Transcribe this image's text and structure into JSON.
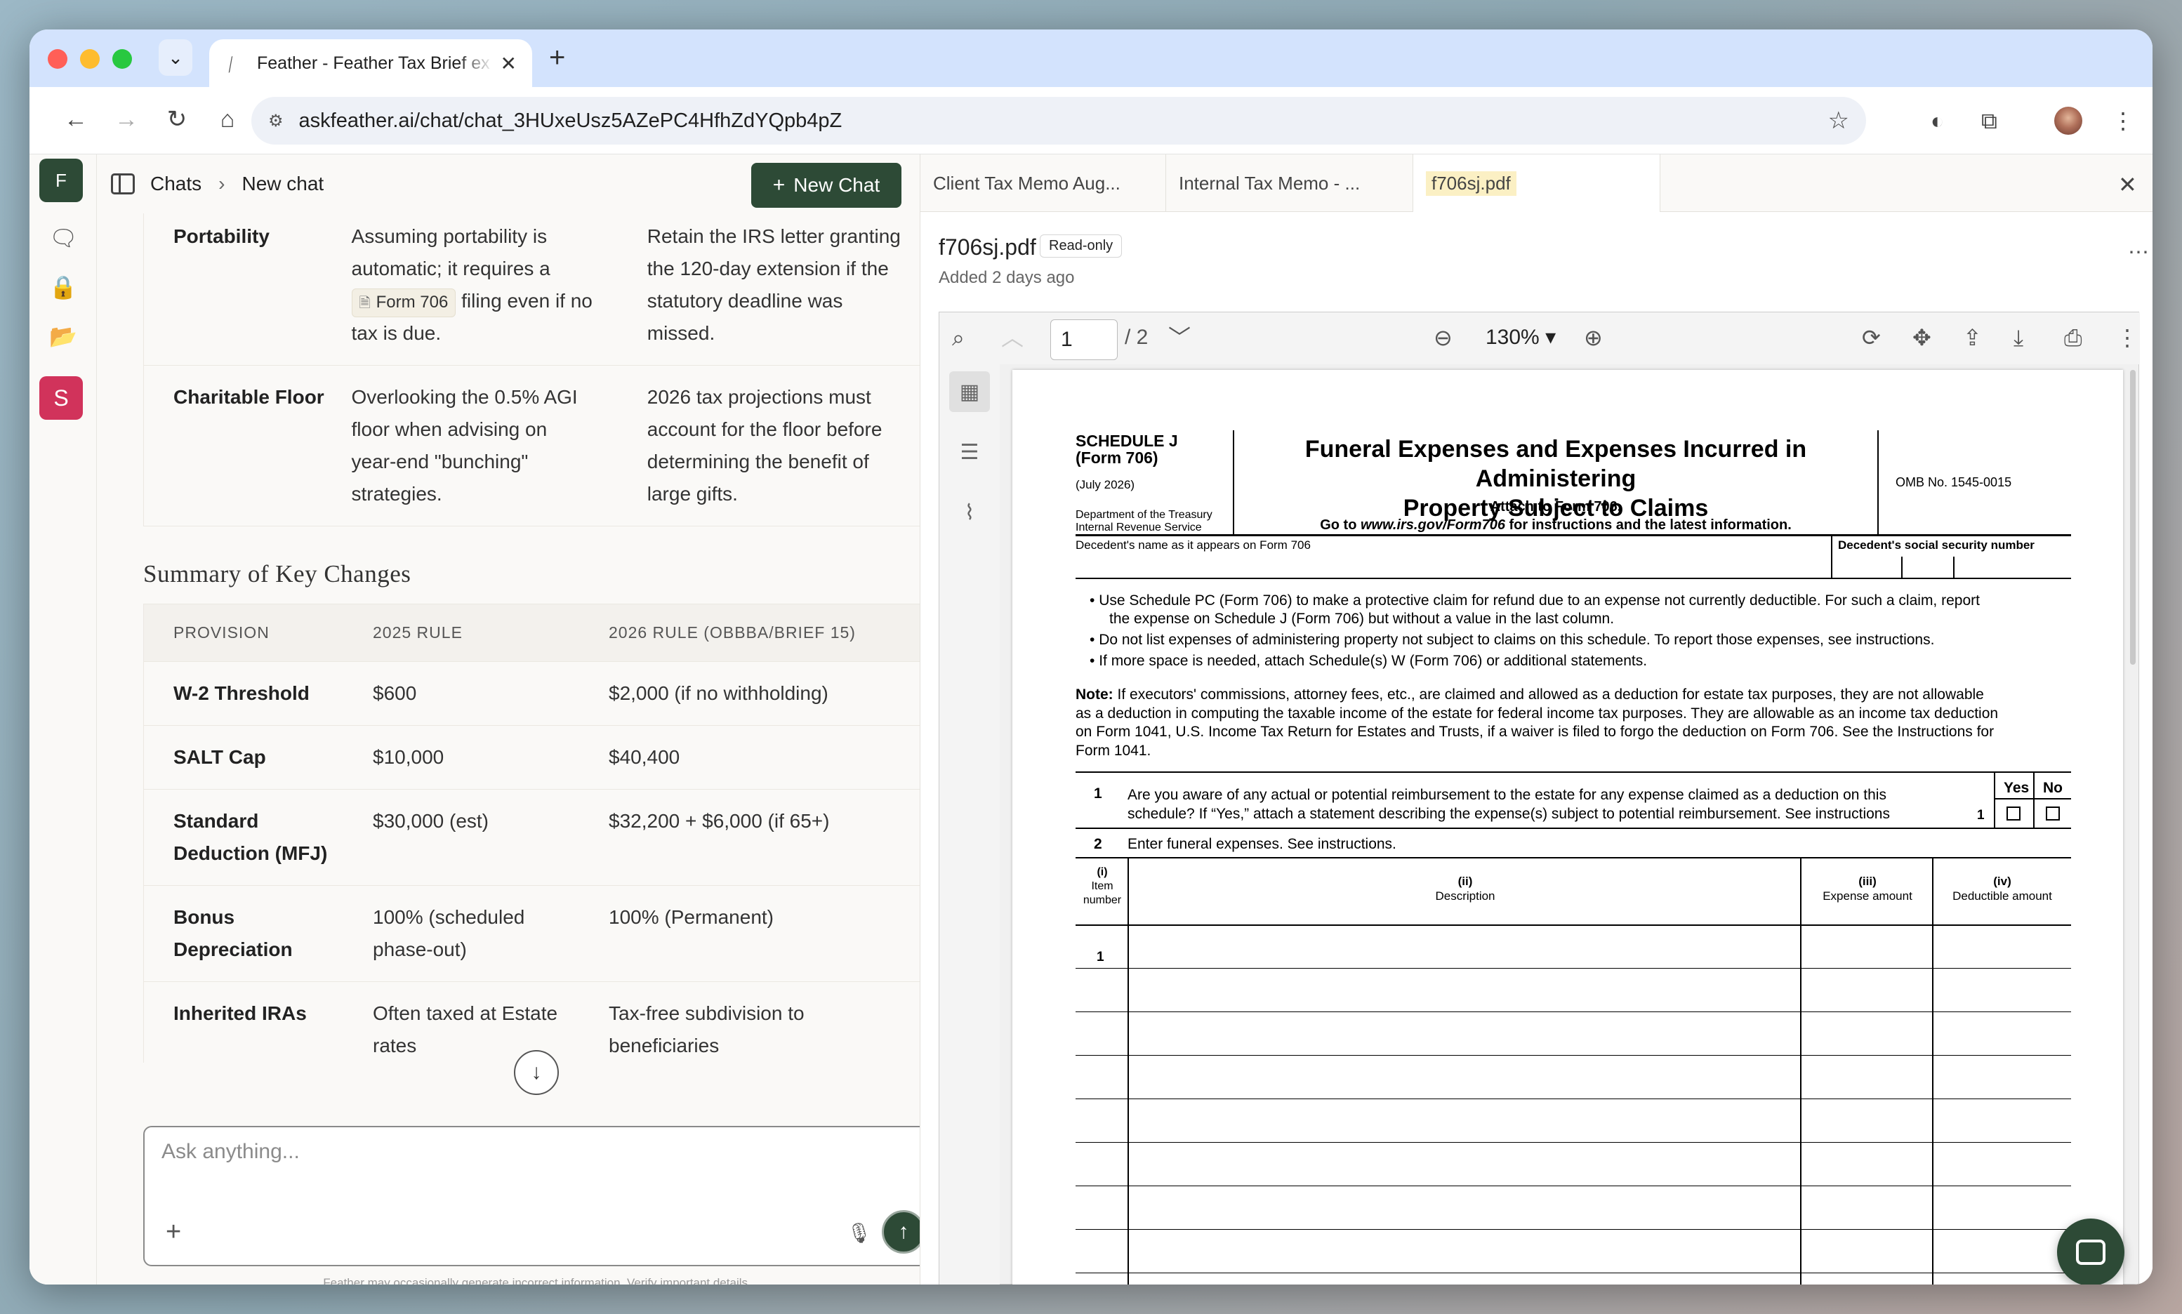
{
  "browser": {
    "tab_title": "Feather - Feather Tax Brief ex",
    "new_tab_icon": "+",
    "url": "askfeather.ai/chat/chat_3HUxeUsz5AZePC4HfhZdYQpb4pZ"
  },
  "rail": {
    "workspace_initial": "F",
    "user_initial": "S",
    "colors": {
      "workspace": "#2d4a36",
      "user": "#d1335b"
    }
  },
  "chat": {
    "breadcrumb_root": "Chats",
    "breadcrumb_current": "New chat",
    "new_chat_label": "New Chat",
    "top_table": [
      {
        "topic": "Portability",
        "pitfall": [
          "Assuming portability is",
          "automatic; it requires a"
        ],
        "chip": "Form 706",
        "pitfall_after_chip": " filing even if no",
        "pitfall_end": "tax is due.",
        "action": [
          "Retain the IRS letter granting",
          "the 120-day extension if the",
          "statutory deadline was",
          "missed."
        ]
      },
      {
        "topic": "Charitable Floor",
        "pitfall": [
          "Overlooking the 0.5% AGI",
          "floor when advising on",
          "year-end \"bunching\"",
          "strategies."
        ],
        "action": [
          "2026 tax projections must",
          "account for the floor before",
          "determining the benefit of",
          "large gifts."
        ]
      }
    ],
    "summary_heading": "Summary of Key Changes",
    "summary_headers": [
      "PROVISION",
      "2025 RULE",
      "2026 RULE (OBBBA/BRIEF 15)"
    ],
    "summary_rows": [
      {
        "provision": "W-2 Threshold",
        "rule_2025": "$600",
        "rule_2026": "$2,000 (if no withholding)"
      },
      {
        "provision": "SALT Cap",
        "rule_2025": "$10,000",
        "rule_2026": "$40,400"
      },
      {
        "provision": "Standard Deduction (MFJ)",
        "rule_2025": "$30,000 (est)",
        "rule_2026": "$32,200 + $6,000 (if 65+)"
      },
      {
        "provision": "Bonus Depreciation",
        "rule_2025": "100% (scheduled phase-out)",
        "rule_2026": "100% (Permanent)"
      },
      {
        "provision": "Inherited IRAs",
        "rule_2025": "Often taxed at Estate rates",
        "rule_2026": "Tax-free subdivision to beneficiaries"
      }
    ],
    "composer_placeholder": "Ask anything...",
    "disclaimer": "Feather may occasionally generate incorrect information. Verify important details."
  },
  "docs": {
    "tabs": [
      "Client Tax Memo Aug...",
      "Internal Tax Memo - ...",
      "f706sj.pdf"
    ],
    "active_tab": "f706sj.pdf",
    "file_name": "f706sj.pdf",
    "badge": "Read-only",
    "added": "Added 2 days ago",
    "page_current": "1",
    "page_total": "/ 2",
    "zoom": "130%"
  },
  "form": {
    "schedule": "SCHEDULE J",
    "form_no": "(Form 706)",
    "rev": "(July 2026)",
    "dept": "Department of the Treasury",
    "irs": "Internal Revenue Service",
    "title1": "Funeral Expenses and Expenses Incurred in Administering",
    "title2": "Property Subject to Claims",
    "attach": "Attach to Form 706.",
    "goto_a": "Go to ",
    "goto_url": "www.irs.gov/Form706",
    "goto_b": " for instructions and the latest information.",
    "omb": "OMB No. 1545-0015",
    "decedent_name": "Decedent's name as it appears on Form 706",
    "decedent_ssn": "Decedent's social security number",
    "bullets": [
      "Use Schedule PC (Form 706) to make a protective claim for refund due to an expense not currently deductible. For such a claim, report",
      "the expense on Schedule J (Form 706) but without a value in the last column.",
      "Do not list expenses of administering property not subject to claims on this schedule. To report those expenses, see instructions.",
      "If more space is needed, attach Schedule(s) W (Form 706) or additional statements."
    ],
    "note_label": "Note:",
    "note_lines": [
      " If executors' commissions, attorney fees, etc., are claimed and allowed as a deduction for estate tax purposes, they are not allowable",
      "as a deduction in computing the taxable income of the estate for federal income tax purposes. They are allowable as an income tax deduction",
      "on Form 1041, U.S. Income Tax Return for Estates and Trusts, if a waiver is filed to forgo the deduction on Form 706. See the Instructions for",
      "Form 1041."
    ],
    "q1_num": "1",
    "q1_a": "Are you aware of any actual or potential reimbursement to the estate for any expense claimed as a deduction on this",
    "q1_b": "schedule? If “Yes,” attach a statement describing the expense(s) subject to potential reimbursement. See instructions",
    "yes": "Yes",
    "no": "No",
    "q1_box": "1",
    "q2_num": "2",
    "q2": "Enter funeral expenses. See instructions.",
    "col_i_num": "(i)",
    "col_i_a": "Item",
    "col_i_b": "number",
    "col_ii_num": "(ii)",
    "col_ii": "Description",
    "col_iii_num": "(iii)",
    "col_iii": "Expense amount",
    "col_iv_num": "(iv)",
    "col_iv": "Deductible amount",
    "row1": "1"
  }
}
